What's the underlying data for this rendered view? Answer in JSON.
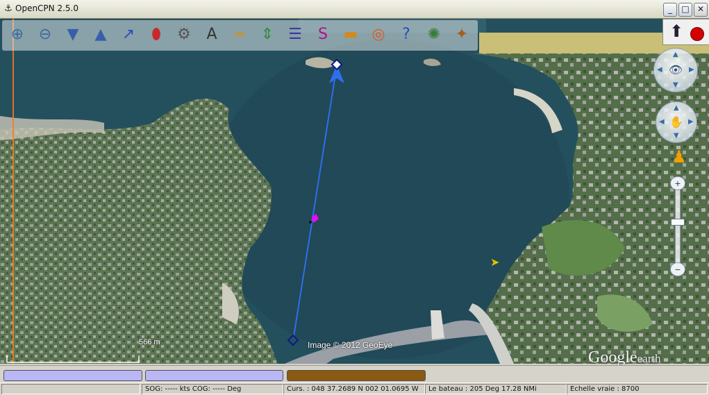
{
  "window": {
    "title": "OpenCPN 2.5.0",
    "app_icon": "opencpn-icon",
    "minimize_glyph": "_",
    "maximize_glyph": "□",
    "close_glyph": "✕"
  },
  "toolbar": {
    "tools": [
      {
        "name": "zoom-in-tool",
        "icon": "magnifier-plus",
        "glyph": "⊕",
        "color": "#3b6aa0"
      },
      {
        "name": "zoom-out-tool",
        "icon": "magnifier-minus",
        "glyph": "⊖",
        "color": "#3b6aa0"
      },
      {
        "name": "scale-down-tool",
        "icon": "triangle-down",
        "glyph": "▼",
        "color": "#3560a8"
      },
      {
        "name": "scale-up-tool",
        "icon": "triangle-up",
        "glyph": "▲",
        "color": "#3560a8"
      },
      {
        "name": "route-tool",
        "icon": "route",
        "glyph": "↗",
        "color": "#2a4fb8"
      },
      {
        "name": "follow-tool",
        "icon": "ship",
        "glyph": "⬮",
        "color": "#c82a2a"
      },
      {
        "name": "settings-tool",
        "icon": "wrench",
        "glyph": "⚙",
        "color": "#555555"
      },
      {
        "name": "text-tool",
        "icon": "text-a",
        "glyph": "A",
        "color": "#333333"
      },
      {
        "name": "current-tool",
        "icon": "current",
        "glyph": "≈",
        "color": "#d09020"
      },
      {
        "name": "tide-tool",
        "icon": "tide",
        "glyph": "⇕",
        "color": "#2d8a3a"
      },
      {
        "name": "route-manager-tool",
        "icon": "route-manager",
        "glyph": "☰",
        "color": "#3a3aa0"
      },
      {
        "name": "track-tool",
        "icon": "track",
        "glyph": "S",
        "color": "#b01090"
      },
      {
        "name": "color-scheme-tool",
        "icon": "sunset",
        "glyph": "▬",
        "color": "#d28a20"
      },
      {
        "name": "mob-tool",
        "icon": "lifebuoy",
        "glyph": "◎",
        "color": "#e05a1a"
      },
      {
        "name": "help-tool",
        "icon": "question-mark",
        "glyph": "?",
        "color": "#2a4fb8"
      },
      {
        "name": "ais-tool",
        "icon": "ais",
        "glyph": "✺",
        "color": "#3a7a3a"
      },
      {
        "name": "plugin-tool",
        "icon": "plugin",
        "glyph": "✦",
        "color": "#a06020"
      }
    ]
  },
  "nav_controls": {
    "compass_icon": "compass-needle-icon",
    "compass_glyph": "⬆",
    "record_color": "#d40000",
    "look_ring_center_glyph": "👁",
    "move_ring_center_glyph": "✋",
    "pegman_glyph": "♟",
    "zoom_in_glyph": "+",
    "zoom_out_glyph": "−",
    "zoom_level": 0.55
  },
  "map": {
    "scale_label": "566  m",
    "copyright": "Image © 2012 GeoEye",
    "google_logo": "Google",
    "google_logo_suffix": "earth",
    "cursor_glyph": "➤",
    "route_color": "#2f6ef0",
    "route_point_color": "#0a1a8a",
    "boat_color": "#ff00ff",
    "water_color": "#26505e",
    "land_color": "#5d7a52"
  },
  "piano": {
    "keys": [
      {
        "name": "piano-key-1",
        "color": "#b9b7f6"
      },
      {
        "name": "piano-key-2",
        "color": "#b9b7f6"
      },
      {
        "name": "piano-key-3",
        "color": "#8a5a12"
      }
    ]
  },
  "status": {
    "sog_cog": "SOG: ----- kts  COG: ----- Deg",
    "cursor": "Curs. : 048 37.2689 N 002 01.0695 W",
    "bearing_distance": "Le bateau : 205 Deg   17.28 NMi",
    "scale": "Echelle vraie :      8700"
  }
}
